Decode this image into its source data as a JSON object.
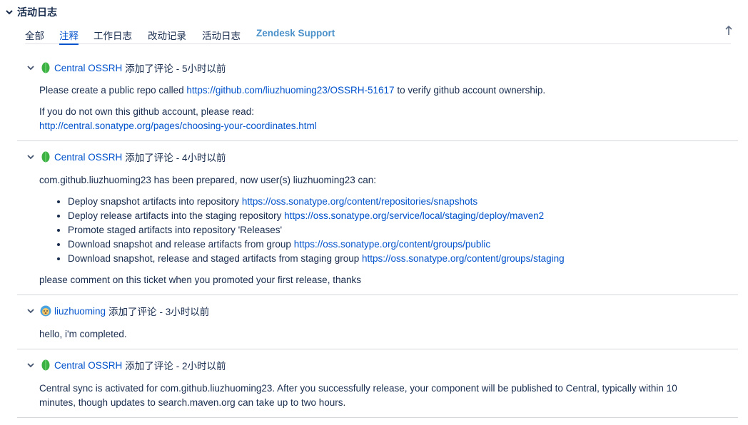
{
  "section": {
    "title": "活动日志"
  },
  "tabs": [
    "全部",
    "注释",
    "工作日志",
    "改动记录",
    "活动日志",
    "Zendesk Support"
  ],
  "comments": [
    {
      "author": "Central OSSRH",
      "action": "添加了评论",
      "time": "- 5小时以前",
      "p1_pre": "Please create a public repo called ",
      "p1_link": "https://github.com/liuzhuoming23/OSSRH-51617",
      "p1_post": " to verify github account ownership.",
      "p2": "If you do not own this github account, please read:",
      "p2_link": "http://central.sonatype.org/pages/choosing-your-coordinates.html"
    },
    {
      "author": "Central OSSRH",
      "action": "添加了评论",
      "time": "- 4小时以前",
      "intro": "com.github.liuzhuoming23 has been prepared, now user(s) liuzhuoming23 can:",
      "items": [
        {
          "text": "Deploy snapshot artifacts into repository ",
          "link": "https://oss.sonatype.org/content/repositories/snapshots"
        },
        {
          "text": "Deploy release artifacts into the staging repository ",
          "link": "https://oss.sonatype.org/service/local/staging/deploy/maven2"
        },
        {
          "text": "Promote staged artifacts into repository 'Releases'",
          "link": ""
        },
        {
          "text": "Download snapshot and release artifacts from group ",
          "link": "https://oss.sonatype.org/content/groups/public"
        },
        {
          "text": "Download snapshot, release and staged artifacts from staging group ",
          "link": "https://oss.sonatype.org/content/groups/staging"
        }
      ],
      "outro": "please comment on this ticket when you promoted your first release, thanks"
    },
    {
      "author": "liuzhuoming",
      "action": "添加了评论",
      "time": "- 3小时以前",
      "text": "hello, i'm completed."
    },
    {
      "author": "Central OSSRH",
      "action": "添加了评论",
      "time": "- 2小时以前",
      "text": "Central sync is activated for com.github.liuzhuoming23. After you successfully release, your component will be published to Central, typically within 10 minutes, though updates to search.maven.org can take up to two hours."
    }
  ]
}
